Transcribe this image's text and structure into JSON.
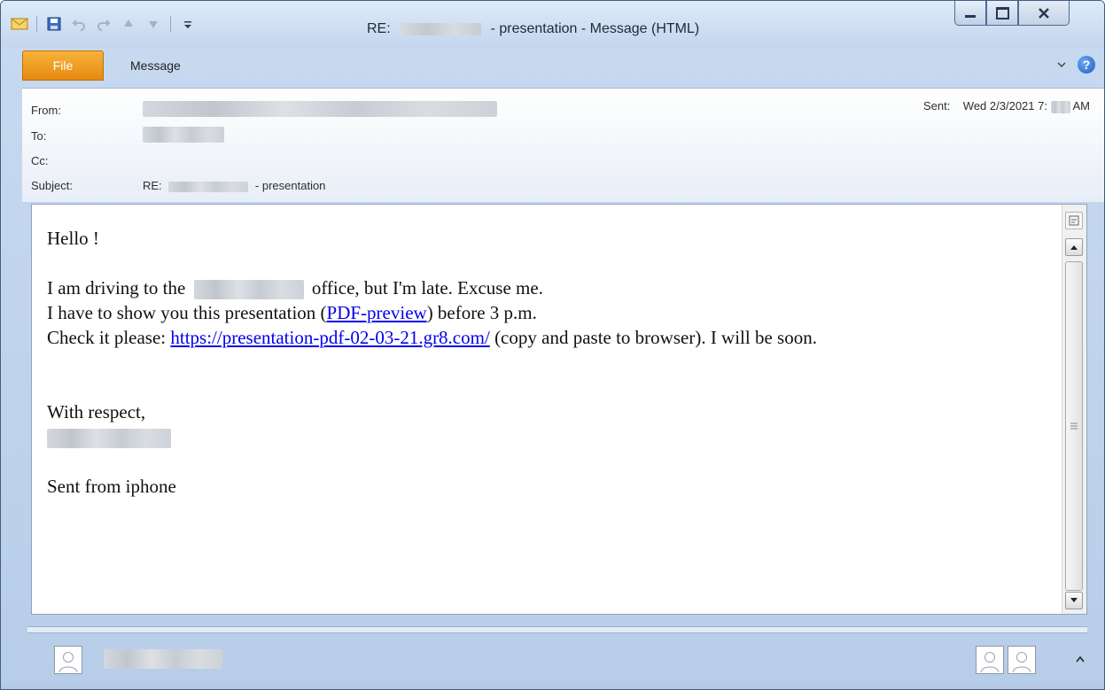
{
  "window": {
    "title_prefix": "RE:",
    "title_suffix": "- presentation  -  Message (HTML)"
  },
  "ribbon": {
    "file_tab": "File",
    "message_tab": "Message"
  },
  "header": {
    "from_label": "From:",
    "to_label": "To:",
    "cc_label": "Cc:",
    "subject_label": "Subject:",
    "subject_prefix": "RE:",
    "subject_suffix": "- presentation",
    "sent_label": "Sent:",
    "sent_date": "Wed 2/3/2021 7:",
    "sent_ampm": "AM"
  },
  "body": {
    "greeting": "Hello !",
    "line1_a": "I am driving to the",
    "line1_b": "office, but I'm late. Excuse me.",
    "line2_a": "I have to show you this presentation (",
    "line2_link": "PDF-preview",
    "line2_b": ") before 3 p.m.",
    "line3_a": "Check it please: ",
    "line3_link": "https://presentation-pdf-02-03-21.gr8.com/",
    "line3_b": " (copy and paste to browser). I will be soon.",
    "closing": "With respect,",
    "signature": "Sent from iphone"
  },
  "colors": {
    "link": "#0000ee",
    "file_tab": "#f0a030",
    "help_icon": "#1d5fc5"
  },
  "icons": {
    "qat": [
      "mail-icon",
      "save-icon",
      "undo-icon",
      "redo-icon",
      "previous-item-icon",
      "next-item-icon",
      "customize-qat-icon"
    ],
    "window": [
      "minimize-icon",
      "maximize-icon",
      "close-icon"
    ]
  }
}
